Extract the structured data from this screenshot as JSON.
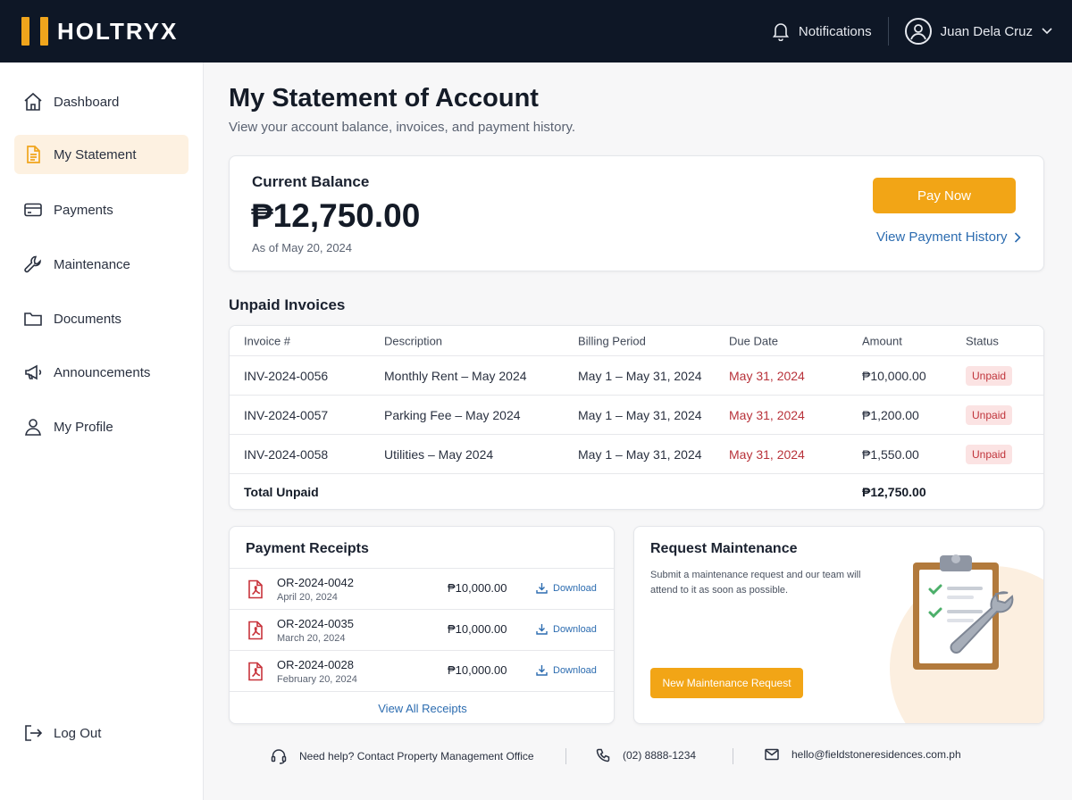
{
  "app": {
    "brand": "HOLTRYX",
    "notifications_label": "Notifications",
    "user_name": "Juan Dela Cruz",
    "accent_color": "#f2a516",
    "header_color": "#0e1726"
  },
  "sidebar": {
    "items": [
      {
        "label": "Dashboard",
        "icon": "home-icon"
      },
      {
        "label": "My Statement",
        "icon": "document-icon",
        "active": true
      },
      {
        "label": "Payments",
        "icon": "credit-card-icon"
      },
      {
        "label": "Maintenance",
        "icon": "wrench-icon"
      },
      {
        "label": "Documents",
        "icon": "folder-icon"
      },
      {
        "label": "Announcements",
        "icon": "megaphone-icon"
      },
      {
        "label": "My Profile",
        "icon": "user-icon"
      }
    ],
    "logout_label": "Log Out"
  },
  "page": {
    "title": "My Statement of Account",
    "subtitle": "View your account balance, invoices, and payment history."
  },
  "balance": {
    "label": "Current Balance",
    "amount": "₱12,750.00",
    "as_of": "As of May 20, 2024",
    "pay_button": "Pay Now",
    "history_link": "View Payment History"
  },
  "invoices": {
    "title": "Unpaid Invoices",
    "columns": [
      "Invoice #",
      "Description",
      "Billing Period",
      "Due Date",
      "Amount",
      "Status"
    ],
    "rows": [
      {
        "invoice": "INV-2024-0056",
        "description": "Monthly Rent – May 2024",
        "period": "May 1 – May 31, 2024",
        "due": "May 31, 2024",
        "amount": "₱10,000.00",
        "status": "Unpaid"
      },
      {
        "invoice": "INV-2024-0057",
        "description": "Parking Fee – May 2024",
        "period": "May 1 – May 31, 2024",
        "due": "May 31, 2024",
        "amount": "₱1,200.00",
        "status": "Unpaid"
      },
      {
        "invoice": "INV-2024-0058",
        "description": "Utilities – May 2024",
        "period": "May 1 – May 31, 2024",
        "due": "May 31, 2024",
        "amount": "₱1,550.00",
        "status": "Unpaid"
      }
    ],
    "total_label": "Total Unpaid",
    "total_amount": "₱12,750.00"
  },
  "receipts": {
    "title": "Payment Receipts",
    "items": [
      {
        "id": "OR-2024-0042",
        "date": "April 20, 2024",
        "amount": "₱10,000.00",
        "action": "Download"
      },
      {
        "id": "OR-2024-0035",
        "date": "March 20, 2024",
        "amount": "₱10,000.00",
        "action": "Download"
      },
      {
        "id": "OR-2024-0028",
        "date": "February 20, 2024",
        "amount": "₱10,000.00",
        "action": "Download"
      }
    ],
    "view_all": "View All Receipts"
  },
  "maintenance": {
    "title": "Request Maintenance",
    "description": "Submit a maintenance request and our team will attend to it as soon as possible.",
    "button": "New Maintenance Request"
  },
  "footer": {
    "help": "Need help? Contact Property Management Office",
    "phone": "(02) 8888-1234",
    "email": "hello@fieldstoneresidences.com.ph"
  }
}
